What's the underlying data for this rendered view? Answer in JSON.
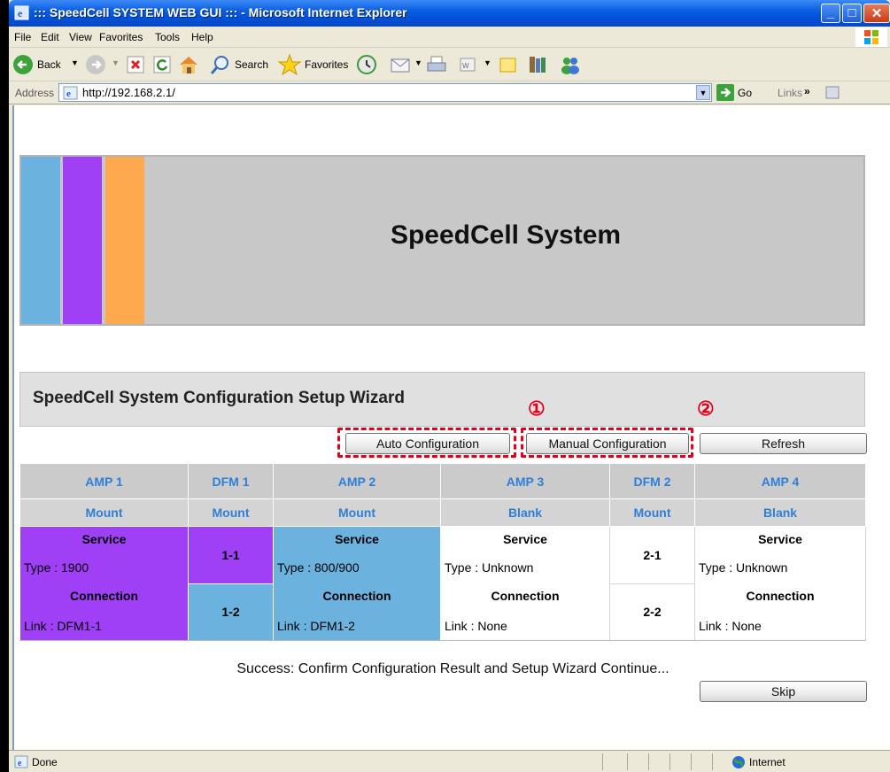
{
  "window": {
    "title": "::: SpeedCell SYSTEM WEB GUI ::: - Microsoft Internet Explorer"
  },
  "menu": [
    "File",
    "Edit",
    "View",
    "Favorites",
    "Tools",
    "Help"
  ],
  "toolbar": {
    "back_label": "Back",
    "search_label": "Search",
    "favorites_label": "Favorites"
  },
  "address": {
    "label": "Address",
    "url": "http://192.168.2.1/",
    "go_label": "Go",
    "links_label": "Links"
  },
  "page": {
    "banner_title": "SpeedCell System",
    "stripe_colors": [
      "#6bb3de",
      "#a040f6",
      "#ffa94f"
    ],
    "wizard_title": "SpeedCell System Configuration Setup Wizard",
    "buttons": {
      "auto": "Auto Configuration",
      "manual": "Manual Configuration",
      "refresh": "Refresh",
      "skip": "Skip"
    },
    "annotations": [
      "①",
      "②"
    ],
    "table": {
      "headers": [
        "AMP 1",
        "DFM 1",
        "AMP 2",
        "AMP 3",
        "DFM 2",
        "AMP 4"
      ],
      "mount": [
        "Mount",
        "Mount",
        "Mount",
        "Blank",
        "Mount",
        "Blank"
      ],
      "amp1": {
        "service": "Service",
        "type": "Type : 1900",
        "connection": "Connection",
        "link": "Link : DFM1-1",
        "color": "#a040f6"
      },
      "dfm1": {
        "slot1": "1-1",
        "slot2": "1-2",
        "color1": "#a040f6",
        "color2": "#6bb3de"
      },
      "amp2": {
        "service": "Service",
        "type": "Type : 800/900",
        "connection": "Connection",
        "link": "Link : DFM1-2",
        "color": "#6bb3de"
      },
      "amp3": {
        "service": "Service",
        "type": "Type : Unknown",
        "connection": "Connection",
        "link": "Link : None"
      },
      "dfm2": {
        "slot1": "2-1",
        "slot2": "2-2"
      },
      "amp4": {
        "service": "Service",
        "type": "Type : Unknown",
        "connection": "Connection",
        "link": "Link : None"
      }
    },
    "status_message": "Success: Confirm Configuration Result and Setup Wizard Continue..."
  },
  "statusbar": {
    "status": "Done",
    "zone": "Internet"
  }
}
